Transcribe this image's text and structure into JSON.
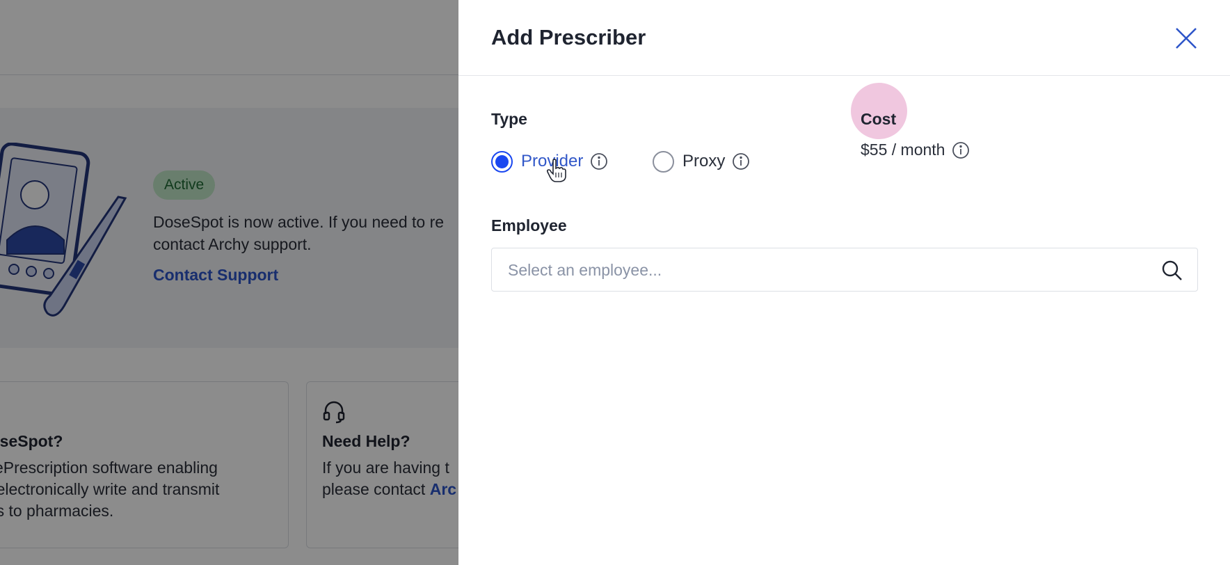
{
  "background": {
    "status_badge": "Active",
    "banner_line1": "DoseSpot is now active. If you need to re",
    "banner_line2": "contact Archy support.",
    "contact_link": "Contact Support",
    "card1": {
      "title": "DoseSpot?",
      "line1": "is ePrescription software enabling",
      "line2": "to electronically write and transmit",
      "line3": "ons to pharmacies."
    },
    "card2": {
      "icon": "headset-icon",
      "title": "Need Help?",
      "line1": "If you are having t",
      "line2_prefix": "please contact ",
      "line2_link": "Arc"
    }
  },
  "drawer": {
    "title": "Add Prescriber",
    "close_icon": "close-icon",
    "type": {
      "label": "Type",
      "options": [
        {
          "label": "Provider",
          "selected": true
        },
        {
          "label": "Proxy",
          "selected": false
        }
      ]
    },
    "cost": {
      "label": "Cost",
      "value": "$55 / month"
    },
    "employee": {
      "label": "Employee",
      "placeholder": "Select an employee..."
    }
  },
  "colors": {
    "accent": "#1a47f0",
    "link": "#2d55c9",
    "badge_bg": "#bfe6c6",
    "cost_highlight": "#f0c7df"
  }
}
